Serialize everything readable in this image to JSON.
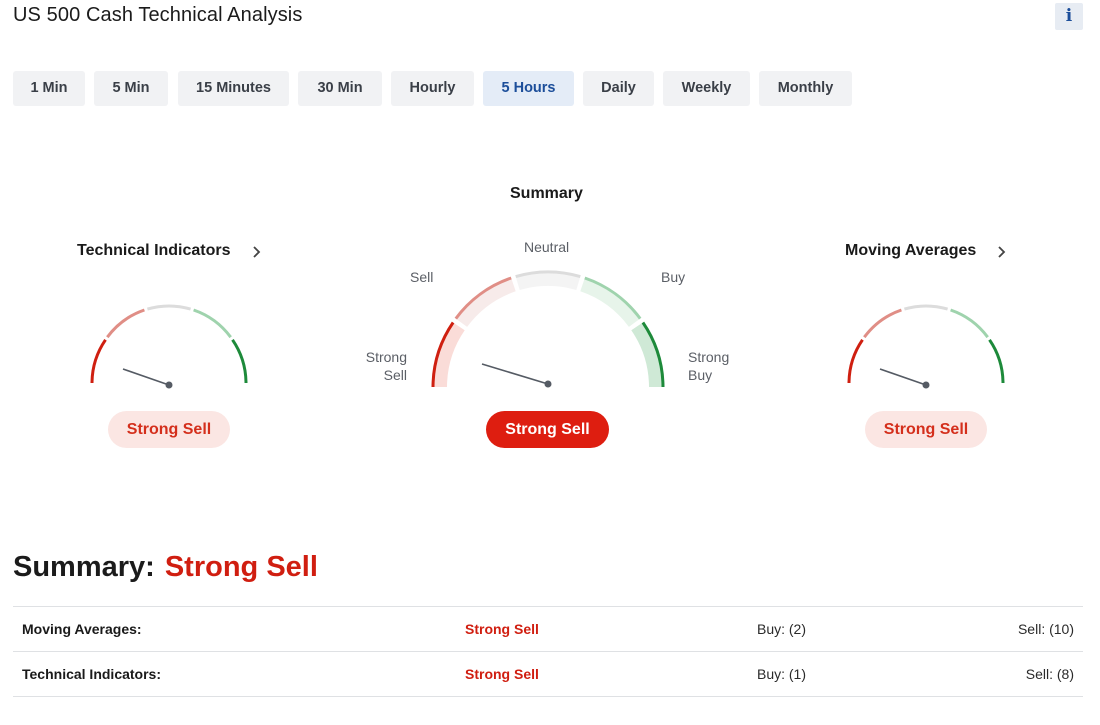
{
  "header": {
    "title": "US 500 Cash Technical Analysis",
    "info_label": "i"
  },
  "timeframes": [
    {
      "label": "1 Min",
      "active": false
    },
    {
      "label": "5 Min",
      "active": false
    },
    {
      "label": "15 Minutes",
      "active": false
    },
    {
      "label": "30 Min",
      "active": false
    },
    {
      "label": "Hourly",
      "active": false
    },
    {
      "label": "5 Hours",
      "active": true
    },
    {
      "label": "Daily",
      "active": false
    },
    {
      "label": "Weekly",
      "active": false
    },
    {
      "label": "Monthly",
      "active": false
    }
  ],
  "gauges": {
    "technical": {
      "title": "Technical Indicators",
      "result": "Strong Sell"
    },
    "summary": {
      "title": "Summary",
      "labels": {
        "neutral": "Neutral",
        "sell": "Sell",
        "buy": "Buy",
        "strong_sell_1": "Strong",
        "strong_sell_2": "Sell",
        "strong_buy_1": "Strong",
        "strong_buy_2": "Buy"
      },
      "result": "Strong Sell"
    },
    "moving": {
      "title": "Moving Averages",
      "result": "Strong Sell"
    }
  },
  "summary_section": {
    "label": "Summary:",
    "value": "Strong Sell",
    "rows": [
      {
        "name": "Moving Averages:",
        "signal": "Strong Sell",
        "buy": "Buy: (2)",
        "sell": "Sell: (10)"
      },
      {
        "name": "Technical Indicators:",
        "signal": "Strong Sell",
        "buy": "Buy: (1)",
        "sell": "Sell: (8)"
      }
    ]
  },
  "colors": {
    "strong_sell": "#cf1f10",
    "sell": "#e08e86",
    "neutral": "#dcdcdc",
    "buy": "#9fd3ad",
    "strong_buy": "#1d8a3a",
    "accent": "#1c4e9a"
  },
  "icons": {
    "info": "info-icon",
    "chevron": "chevron-right-icon"
  }
}
